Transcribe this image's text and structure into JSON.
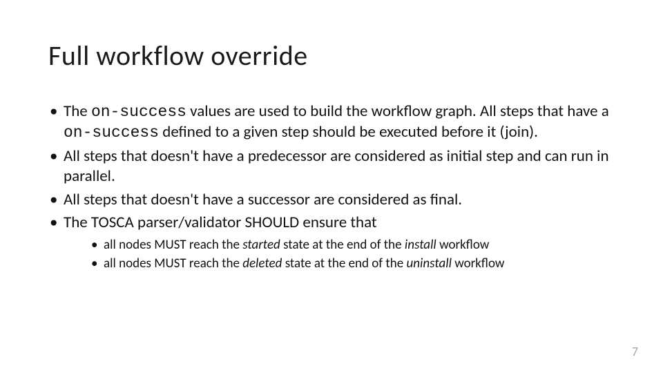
{
  "title": "Full workflow override",
  "b1": {
    "t1": "The ",
    "code1": "on-success",
    "t2": " values are used to build the workflow graph. All steps that have a ",
    "code2": "on-success",
    "t3": " defined to a given step should be executed before it (join)."
  },
  "b2": "All steps that doesn't have a predecessor are considered as initial step and can run in parallel.",
  "b3": "All steps that doesn't have a successor are considered as final.",
  "b4": "The TOSCA parser/validator SHOULD ensure that",
  "s1": {
    "t1": "all nodes MUST reach the ",
    "i1": "started",
    "t2": " state at the end of the ",
    "i2": "install",
    "t3": " workflow"
  },
  "s2": {
    "t1": "all nodes MUST reach the ",
    "i1": "deleted",
    "t2": " state at the end of the ",
    "i2": "uninstall",
    "t3": " workflow"
  },
  "page": "7"
}
